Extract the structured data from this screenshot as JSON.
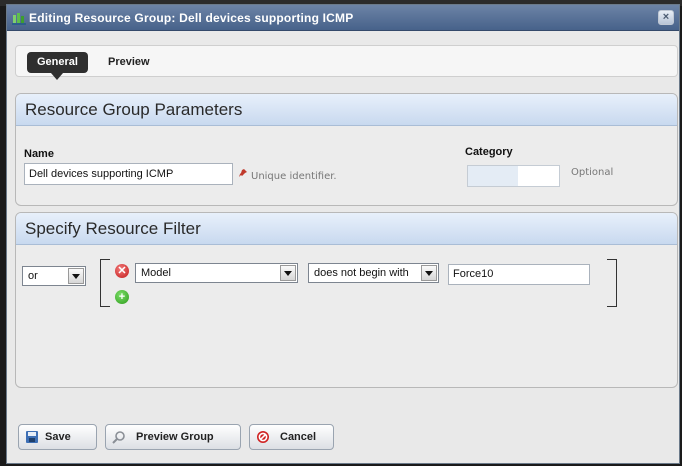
{
  "dialog": {
    "title": "Editing Resource Group: Dell devices supporting ICMP",
    "close_symbol": "×"
  },
  "tabs": [
    {
      "label": "General",
      "active": true
    },
    {
      "label": "Preview",
      "active": false
    }
  ],
  "parameters": {
    "heading": "Resource Group Parameters",
    "name_label": "Name",
    "name_value": "Dell devices supporting ICMP",
    "name_hint": "Unique identifier.",
    "category_label": "Category",
    "category_value": "",
    "category_hint": "Optional"
  },
  "filter": {
    "heading": "Specify Resource Filter",
    "operator": "or",
    "rule": {
      "field": "Model",
      "condition": "does not begin with",
      "value": "Force10"
    }
  },
  "buttons": {
    "save": "Save",
    "preview": "Preview Group",
    "cancel": "Cancel"
  },
  "colors": {
    "titlebar": "#47628a",
    "panel_header": "#c8d9ef",
    "remove": "#c21a1a",
    "add": "#2c9a1a"
  },
  "icons": [
    "resource-group-icon",
    "close-icon",
    "required-pin-icon",
    "remove-rule-icon",
    "add-rule-icon",
    "save-disk-icon",
    "magnifier-icon",
    "cancel-icon"
  ]
}
